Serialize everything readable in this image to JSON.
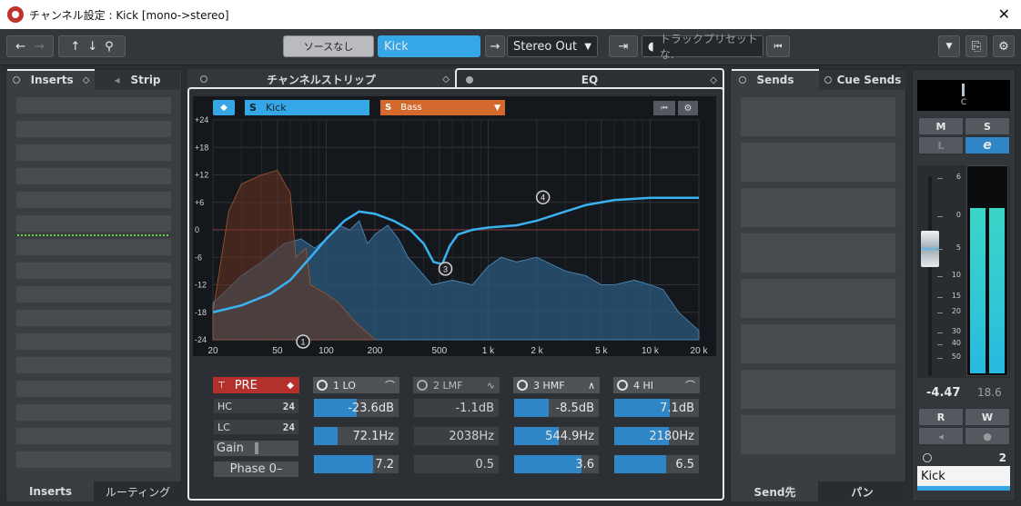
{
  "window": {
    "title": "チャンネル設定 : Kick [mono->stereo]"
  },
  "toolbar": {
    "source": "ソースなし",
    "channel_name": "Kick",
    "output": "Stereo Out",
    "track_preset_placeholder": "トラックプリセットな."
  },
  "inserts_panel": {
    "tab_inserts": "Inserts",
    "tab_strip": "Strip",
    "bottom_inserts": "Inserts",
    "bottom_routing": "ルーティング"
  },
  "center_tabs": {
    "channel_strip": "チャンネルストリップ",
    "eq": "EQ"
  },
  "eq": {
    "preset": "Kick",
    "type": "Bass",
    "db_ticks": [
      "+24",
      "+18",
      "+12",
      "+6",
      "0",
      "-6",
      "-12",
      "-18",
      "-24"
    ],
    "freq_ticks": [
      "20",
      "50",
      "100",
      "200",
      "500",
      "1 k",
      "2 k",
      "5 k",
      "10 k",
      "20 k"
    ],
    "node_labels": [
      "1",
      "3",
      "4"
    ],
    "pre": {
      "label": "PRE",
      "hc_label": "HC",
      "hc_value": "24",
      "lc_label": "LC",
      "lc_value": "24",
      "gain_label": "Gain",
      "phase_label": "Phase 0–"
    },
    "bands": [
      {
        "name": "1 LO",
        "gain": "-23.6dB",
        "gain_fill": 0.51,
        "freq": "72.1Hz",
        "freq_fill": 0.28,
        "q": "7.2",
        "q_fill": 0.7
      },
      {
        "name": "2 LMF",
        "gain": "-1.1dB",
        "gain_fill": 0.0,
        "freq": "2038Hz",
        "freq_fill": 0.0,
        "q": "0.5",
        "q_fill": 0.0
      },
      {
        "name": "3 HMF",
        "gain": "-8.5dB",
        "gain_fill": 0.41,
        "freq": "544.9Hz",
        "freq_fill": 0.53,
        "q": "3.6",
        "q_fill": 0.8
      },
      {
        "name": "4 HI",
        "gain": "7.1dB",
        "gain_fill": 0.66,
        "freq": "2180Hz",
        "freq_fill": 0.64,
        "q": "6.5",
        "q_fill": 0.61
      }
    ]
  },
  "sends_panel": {
    "tab_sends": "Sends",
    "tab_cue": "Cue Sends",
    "bottom_dest": "Send先",
    "bottom_pan": "パン"
  },
  "fader_panel": {
    "pan_value": "C",
    "mute": "M",
    "solo": "S",
    "listen": "L",
    "edit": "e",
    "scale": [
      "6",
      "0",
      "5",
      "10",
      "15",
      "20",
      "30",
      "40",
      "50"
    ],
    "level": "-4.47",
    "peak": "18.6",
    "read": "R",
    "write": "W",
    "channel_number": "2",
    "channel_name": "Kick"
  },
  "colors": {
    "accent": "#36a7e6",
    "pre_red": "#b3302d",
    "type_orange": "#d4692e",
    "meter": "#3ad6c8"
  }
}
